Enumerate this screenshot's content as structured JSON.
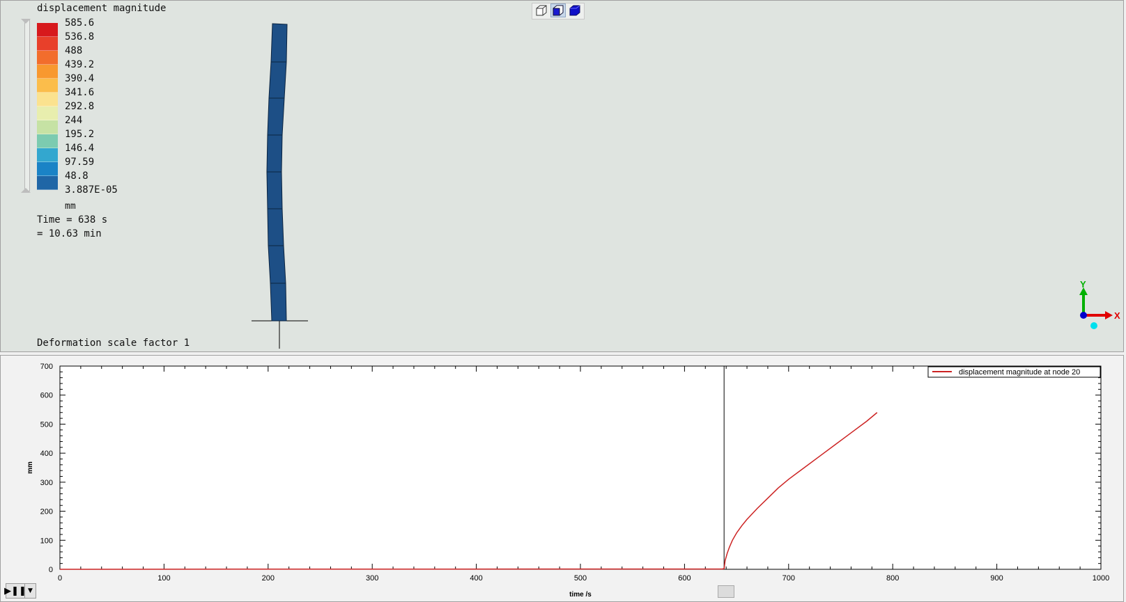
{
  "viewport": {
    "legend_title": "displacement magnitude",
    "legend_values": [
      "585.6",
      "536.8",
      "488",
      "439.2",
      "390.4",
      "341.6",
      "292.8",
      "244",
      "195.2",
      "146.4",
      "97.59",
      "48.8",
      "3.887E-05"
    ],
    "legend_colors": [
      "#d7191c",
      "#e8402a",
      "#f26d2c",
      "#f8982f",
      "#fbbd4b",
      "#fbe28f",
      "#e8eeae",
      "#c6e2a4",
      "#7ccbb0",
      "#33a7cf",
      "#1a83c6",
      "#1f66a6",
      "#1d4f86"
    ],
    "unit": "mm",
    "time_line1": "Time = 638 s",
    "time_line2": "= 10.63 min",
    "scale_label": "Deformation scale factor 1",
    "beam_color": "#1d4f86",
    "axes": {
      "x_label": "X",
      "y_label": "Y"
    },
    "toolbar": {
      "buttons": [
        "wireframe-view-icon",
        "hidden-line-view-icon",
        "shaded-view-icon"
      ]
    }
  },
  "chart_data": {
    "type": "line",
    "xlabel": "time /s",
    "ylabel": "mm",
    "xlim": [
      0,
      1000
    ],
    "ylim": [
      0,
      700
    ],
    "xticks": [
      0,
      100,
      200,
      300,
      400,
      500,
      600,
      700,
      800,
      900,
      1000
    ],
    "yticks": [
      0,
      100,
      200,
      300,
      400,
      500,
      600,
      700
    ],
    "cursor_x": 638,
    "legend_position": "top-right",
    "series": [
      {
        "name": "displacement magnitude at node 20",
        "color": "#cc2222",
        "x": [
          0,
          170,
          600,
          636,
          638,
          639,
          641,
          643,
          646,
          650,
          655,
          660,
          670,
          680,
          690,
          700,
          715,
          730,
          745,
          760,
          775,
          785
        ],
        "y": [
          0,
          0.5,
          1,
          1,
          2,
          30,
          55,
          75,
          100,
          125,
          150,
          172,
          210,
          245,
          280,
          310,
          350,
          390,
          430,
          470,
          510,
          540
        ]
      }
    ]
  }
}
